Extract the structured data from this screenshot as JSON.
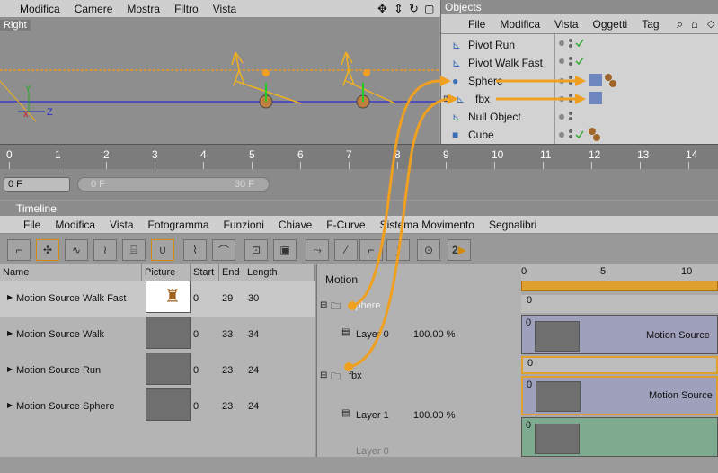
{
  "menubar_top": {
    "items": [
      "Modifica",
      "Camere",
      "Mostra",
      "Filtro",
      "Vista"
    ]
  },
  "viewport": {
    "label": "Right"
  },
  "objects": {
    "title": "Objects",
    "menu": [
      "File",
      "Modifica",
      "Vista",
      "Oggetti",
      "Tag"
    ],
    "items": [
      "Pivot Run",
      "Pivot Walk Fast",
      "Sphere",
      "fbx",
      "Null Object",
      "Cube"
    ]
  },
  "ruler": {
    "ticks": [
      "0",
      "1",
      "2",
      "3",
      "4",
      "5",
      "6",
      "7",
      "8",
      "9",
      "10",
      "11",
      "12",
      "13",
      "14"
    ]
  },
  "framebar": {
    "current": "0 F",
    "start": "0 F",
    "end": "30 F"
  },
  "timeline": {
    "title": "Timeline",
    "menu": [
      "File",
      "Modifica",
      "Vista",
      "Fotogramma",
      "Funzioni",
      "Chiave",
      "F-Curve",
      "Sistema Movimento",
      "Segnalibri"
    ],
    "columns": {
      "name": "Name",
      "picture": "Picture",
      "start": "Start",
      "end": "End",
      "length": "Length"
    },
    "sources": [
      {
        "name": "Motion Source Walk Fast",
        "start": "0",
        "end": "29",
        "length": "30"
      },
      {
        "name": "Motion Source Walk",
        "start": "0",
        "end": "33",
        "length": "34"
      },
      {
        "name": "Motion Source Run",
        "start": "0",
        "end": "23",
        "length": "24"
      },
      {
        "name": "Motion Source Sphere",
        "start": "0",
        "end": "23",
        "length": "24"
      }
    ],
    "motion_header": "Motion",
    "motion_rows": [
      {
        "name": "Sphere",
        "pct": ""
      },
      {
        "name": "Layer 0",
        "pct": "100.00 %"
      },
      {
        "name": "fbx",
        "pct": ""
      },
      {
        "name": "Layer 1",
        "pct": "100.00 %"
      },
      {
        "name": "Layer 0",
        "pct": ""
      }
    ],
    "track_ruler": [
      "0",
      "5",
      "10"
    ],
    "clip_labels": [
      "Motion Source",
      "Motion Source"
    ],
    "track_zero": "0",
    "toolbar_badge": "2"
  },
  "colors": {
    "accent": "#f0a020",
    "tick_green": "#3a3"
  }
}
